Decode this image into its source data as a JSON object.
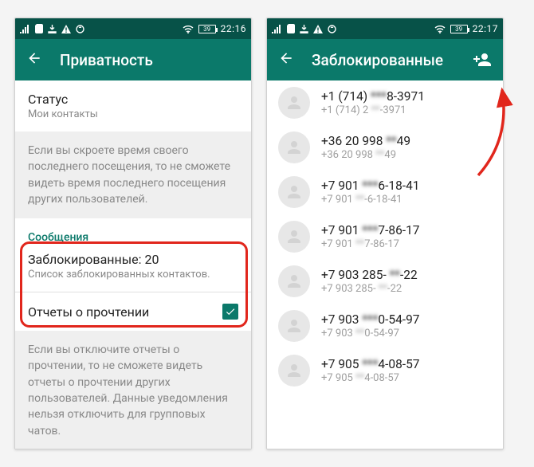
{
  "left": {
    "status": {
      "battery": "39",
      "time": "22:16"
    },
    "appbar": {
      "title": "Приватность"
    },
    "status_section": {
      "label": "Статус",
      "sub": "Мои контакты"
    },
    "info1": "Если вы скроете время своего последнего посещения, то не сможете видеть время последнего посещения других пользователей.",
    "messages": {
      "heading": "Сообщения",
      "blocked_label": "Заблокированные: 20",
      "blocked_sub": "Список заблокированных контактов."
    },
    "read_receipts": {
      "label": "Отчеты о прочтении"
    },
    "info2": "Если вы отключите отчеты о прочтении, то не сможете видеть отчеты о прочтении других пользователей. Данные уведомления нельзя отключить для групповых чатов."
  },
  "right": {
    "status": {
      "battery": "39",
      "time": "22:17"
    },
    "appbar": {
      "title": "Заблокированные"
    },
    "contacts": [
      {
        "a": "+1 (714)",
        "ah": "***",
        "b": "8-3971",
        "c": "+1 (714) 2",
        "ch": "**",
        "d": "-3971"
      },
      {
        "a": "+36 20 998",
        "ah": "**",
        "b": "49",
        "c": "+36 20 998",
        "ch": "**",
        "d": "49"
      },
      {
        "a": "+7 901",
        "ah": "***",
        "b": "6-18-41",
        "c": "+7 901",
        "ch": "**",
        "d": "-6-18-41"
      },
      {
        "a": "+7 901",
        "ah": "***",
        "b": "7-86-17",
        "c": "+7 901",
        "ch": "**",
        "d": "7-86-17"
      },
      {
        "a": "+7 903 285-",
        "ah": "**",
        "b": "-22",
        "c": "+7 903 285-",
        "ch": "**",
        "d": "-22"
      },
      {
        "a": "+7 903",
        "ah": "***",
        "b": "0-54-97",
        "c": "+7 903",
        "ch": "**",
        "d": "0-54-97"
      },
      {
        "a": "+7 905",
        "ah": "***",
        "b": "4-08-57",
        "c": "+7 905",
        "ch": "**",
        "d": "4-08-57"
      }
    ]
  }
}
